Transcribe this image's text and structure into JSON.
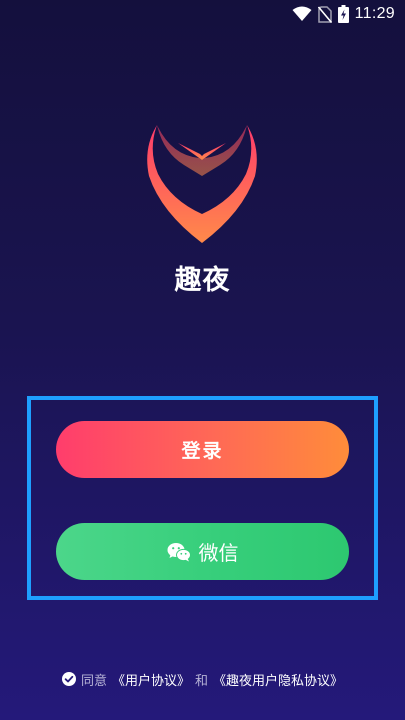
{
  "status_bar": {
    "time": "11:29",
    "icons": [
      "wifi-icon",
      "no-sim-icon",
      "battery-charging-icon"
    ]
  },
  "app": {
    "logo_icon": "heart-logo-icon",
    "name": "趣夜"
  },
  "buttons": {
    "login_label": "登录",
    "wechat_label": "微信",
    "wechat_icon": "wechat-icon"
  },
  "agreement": {
    "check_icon": "check-circle-icon",
    "prefix": "同意",
    "user_agreement": "《用户协议》",
    "conjunction": "和",
    "privacy_agreement": "《趣夜用户隐私协议》"
  },
  "colors": {
    "background_top": "#14103d",
    "background_bottom": "#24197a",
    "login_gradient_start": "#ff3d6c",
    "login_gradient_end": "#ff8c3a",
    "wechat_gradient_start": "#4cd68a",
    "wechat_gradient_end": "#2dc870",
    "highlight_border": "#1e9fff"
  }
}
